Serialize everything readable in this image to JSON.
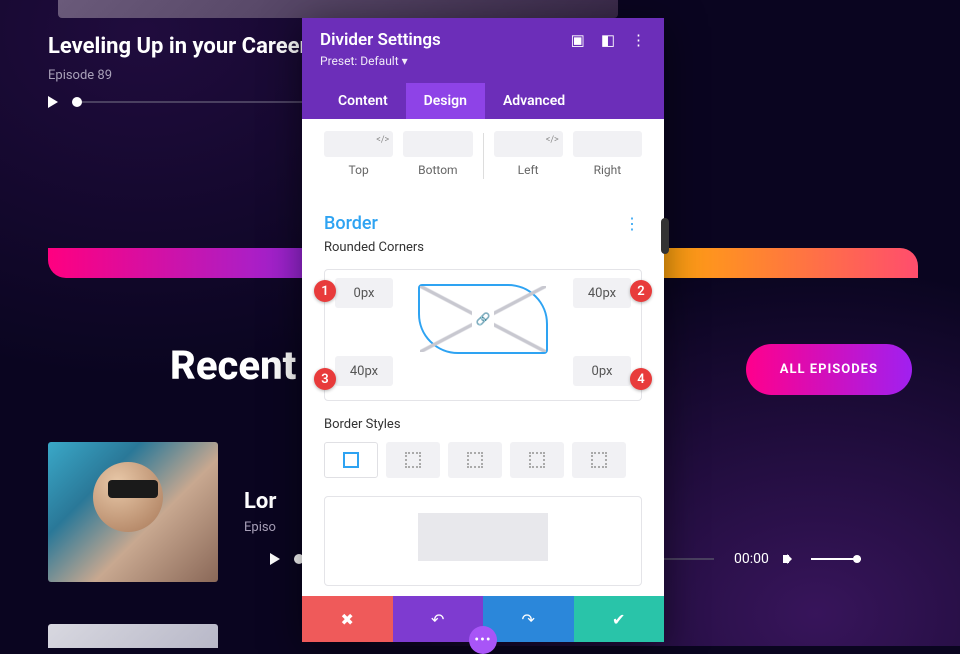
{
  "hero": {
    "title": "Leveling Up in your Career, w",
    "subtitle": "Episode 89"
  },
  "recent": {
    "title": "Recent",
    "all_btn": "ALL EPISODES",
    "ep_title": "Lor",
    "ep_sub": "Episo",
    "time": "00:00"
  },
  "modal": {
    "title": "Divider Settings",
    "preset": "Preset: Default ▾",
    "tabs": {
      "content": "Content",
      "design": "Design",
      "advanced": "Advanced"
    },
    "spacing": {
      "top": "Top",
      "bottom": "Bottom",
      "left": "Left",
      "right": "Right"
    },
    "border": {
      "head": "Border",
      "corners_label": "Rounded Corners",
      "tl": "0px",
      "tr": "40px",
      "bl": "40px",
      "br": "0px",
      "styles_label": "Border Styles"
    },
    "markers": {
      "m1": "1",
      "m2": "2",
      "m3": "3",
      "m4": "4"
    }
  }
}
